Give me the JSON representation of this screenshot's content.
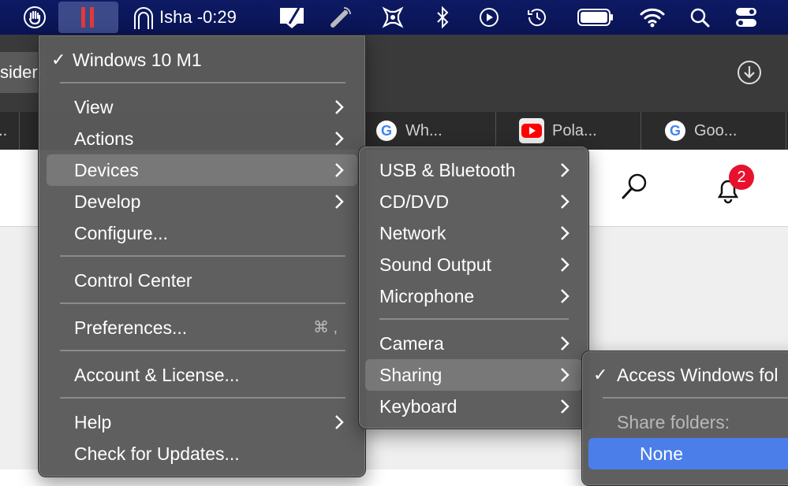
{
  "menubar": {
    "user_label": "Isha -0:29"
  },
  "browser": {
    "url_fragment": "sider-",
    "tab_left_fragment": "v...",
    "tabs": [
      {
        "icon": "google-icon",
        "title": "Wh..."
      },
      {
        "icon": "youtube-icon",
        "title": "Pola..."
      },
      {
        "icon": "google-icon",
        "title": "Goo..."
      }
    ],
    "notification_count": "2"
  },
  "main_menu": {
    "vm_name": "Windows 10 M1",
    "items": {
      "view": "View",
      "actions": "Actions",
      "devices": "Devices",
      "develop": "Develop",
      "configure": "Configure...",
      "control_center": "Control Center",
      "preferences": "Preferences...",
      "preferences_shortcut": "⌘ ,",
      "account_license": "Account & License...",
      "help": "Help",
      "check_updates": "Check for Updates..."
    }
  },
  "devices_menu": {
    "items": {
      "usb": "USB & Bluetooth",
      "cddvd": "CD/DVD",
      "network": "Network",
      "sound_output": "Sound Output",
      "microphone": "Microphone",
      "camera": "Camera",
      "sharing": "Sharing",
      "keyboard": "Keyboard"
    }
  },
  "sharing_menu": {
    "access_windows": "Access Windows fol",
    "share_folders_header": "Share folders:",
    "none": "None"
  },
  "colors": {
    "menubar": "#0d1a63",
    "menu_bg": "#5a5a5a",
    "selection_blue": "#4b7ee8",
    "badge_red": "#e8112d"
  }
}
